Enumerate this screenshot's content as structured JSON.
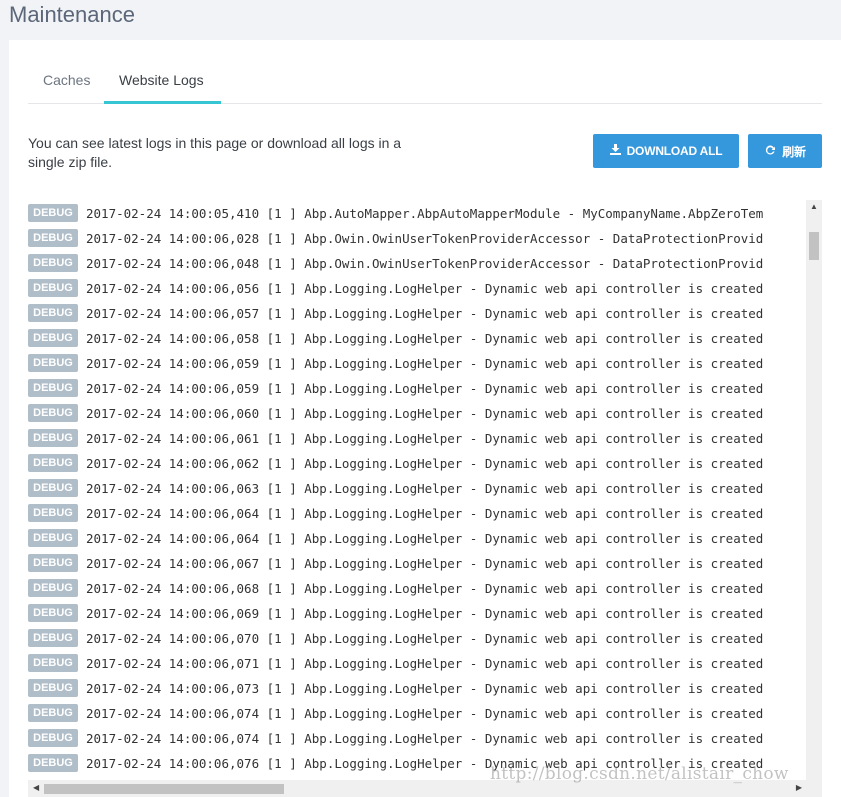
{
  "page": {
    "title": "Maintenance"
  },
  "tabs": [
    {
      "label": "Caches"
    },
    {
      "label": "Website Logs"
    }
  ],
  "description": "You can see latest logs in this page or download all logs in a single zip file.",
  "buttons": {
    "download_label": "DOWNLOAD ALL",
    "refresh_label": "刷新"
  },
  "colors": {
    "accent": "#3598dc",
    "tab_active": "#36c6d3",
    "badge": "#b0bec9"
  },
  "logs": [
    {
      "level": "DEBUG",
      "text": "2017-02-24 14:00:05,410 [1 ] Abp.AutoMapper.AbpAutoMapperModule - MyCompanyName.AbpZeroTem"
    },
    {
      "level": "DEBUG",
      "text": "2017-02-24 14:00:06,028 [1 ] Abp.Owin.OwinUserTokenProviderAccessor - DataProtectionProvid"
    },
    {
      "level": "DEBUG",
      "text": "2017-02-24 14:00:06,048 [1 ] Abp.Owin.OwinUserTokenProviderAccessor - DataProtectionProvid"
    },
    {
      "level": "DEBUG",
      "text": "2017-02-24 14:00:06,056 [1 ] Abp.Logging.LogHelper - Dynamic web api controller is created"
    },
    {
      "level": "DEBUG",
      "text": "2017-02-24 14:00:06,057 [1 ] Abp.Logging.LogHelper - Dynamic web api controller is created"
    },
    {
      "level": "DEBUG",
      "text": "2017-02-24 14:00:06,058 [1 ] Abp.Logging.LogHelper - Dynamic web api controller is created"
    },
    {
      "level": "DEBUG",
      "text": "2017-02-24 14:00:06,059 [1 ] Abp.Logging.LogHelper - Dynamic web api controller is created"
    },
    {
      "level": "DEBUG",
      "text": "2017-02-24 14:00:06,059 [1 ] Abp.Logging.LogHelper - Dynamic web api controller is created"
    },
    {
      "level": "DEBUG",
      "text": "2017-02-24 14:00:06,060 [1 ] Abp.Logging.LogHelper - Dynamic web api controller is created"
    },
    {
      "level": "DEBUG",
      "text": "2017-02-24 14:00:06,061 [1 ] Abp.Logging.LogHelper - Dynamic web api controller is created"
    },
    {
      "level": "DEBUG",
      "text": "2017-02-24 14:00:06,062 [1 ] Abp.Logging.LogHelper - Dynamic web api controller is created"
    },
    {
      "level": "DEBUG",
      "text": "2017-02-24 14:00:06,063 [1 ] Abp.Logging.LogHelper - Dynamic web api controller is created"
    },
    {
      "level": "DEBUG",
      "text": "2017-02-24 14:00:06,064 [1 ] Abp.Logging.LogHelper - Dynamic web api controller is created"
    },
    {
      "level": "DEBUG",
      "text": "2017-02-24 14:00:06,064 [1 ] Abp.Logging.LogHelper - Dynamic web api controller is created"
    },
    {
      "level": "DEBUG",
      "text": "2017-02-24 14:00:06,067 [1 ] Abp.Logging.LogHelper - Dynamic web api controller is created"
    },
    {
      "level": "DEBUG",
      "text": "2017-02-24 14:00:06,068 [1 ] Abp.Logging.LogHelper - Dynamic web api controller is created"
    },
    {
      "level": "DEBUG",
      "text": "2017-02-24 14:00:06,069 [1 ] Abp.Logging.LogHelper - Dynamic web api controller is created"
    },
    {
      "level": "DEBUG",
      "text": "2017-02-24 14:00:06,070 [1 ] Abp.Logging.LogHelper - Dynamic web api controller is created"
    },
    {
      "level": "DEBUG",
      "text": "2017-02-24 14:00:06,071 [1 ] Abp.Logging.LogHelper - Dynamic web api controller is created"
    },
    {
      "level": "DEBUG",
      "text": "2017-02-24 14:00:06,073 [1 ] Abp.Logging.LogHelper - Dynamic web api controller is created"
    },
    {
      "level": "DEBUG",
      "text": "2017-02-24 14:00:06,074 [1 ] Abp.Logging.LogHelper - Dynamic web api controller is created"
    },
    {
      "level": "DEBUG",
      "text": "2017-02-24 14:00:06,074 [1 ] Abp.Logging.LogHelper - Dynamic web api controller is created"
    },
    {
      "level": "DEBUG",
      "text": "2017-02-24 14:00:06,076 [1 ] Abp.Logging.LogHelper - Dynamic web api controller is created"
    }
  ],
  "watermark": "http://blog.csdn.net/alistair_chow"
}
